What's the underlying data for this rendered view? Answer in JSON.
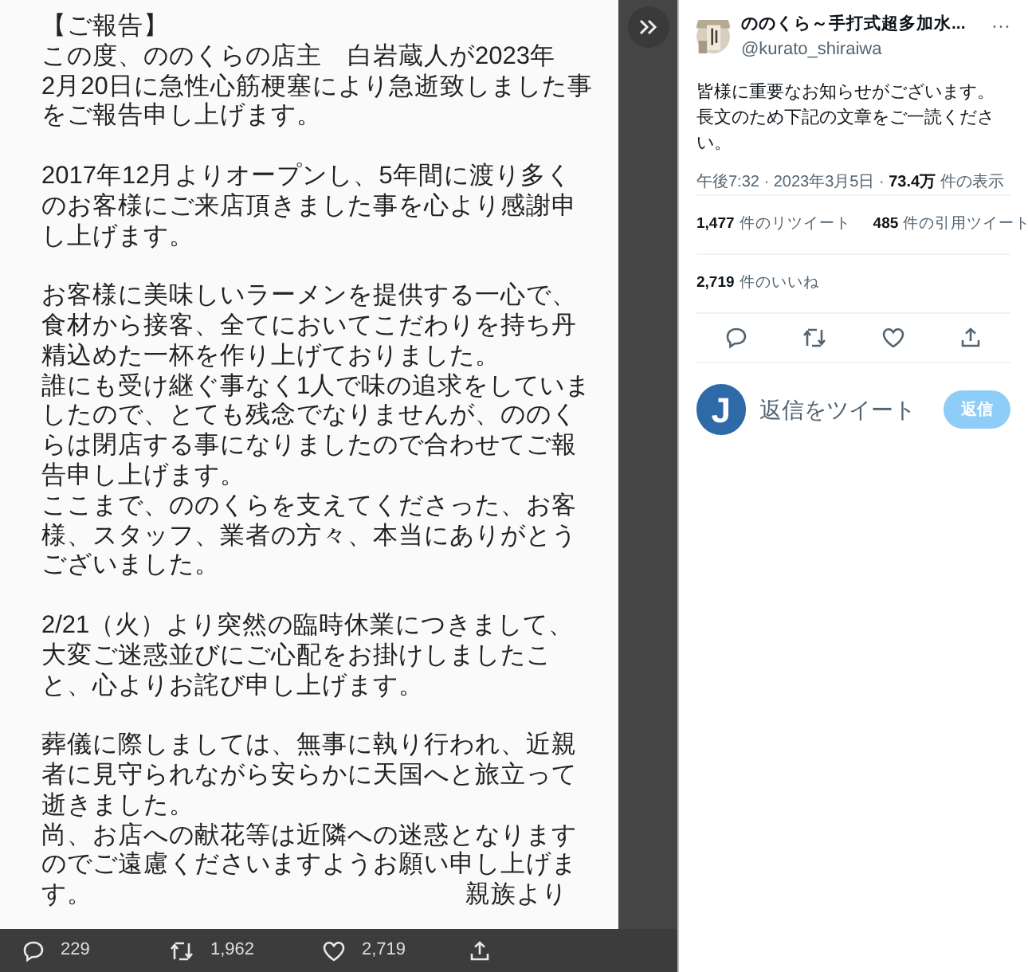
{
  "notice_image": {
    "paragraphs": [
      [
        "【ご報告】",
        "この度、ののくらの店主　白岩蔵人が2023年",
        "2月20日に急性心筋梗塞により急逝致しました事",
        "をご報告申し上げます。"
      ],
      [
        "2017年12月よりオープンし、5年間に渡り多く",
        "のお客様にご来店頂きました事を心より感謝申",
        "し上げます。"
      ],
      [
        "お客様に美味しいラーメンを提供する一心で、",
        "食材から接客、全てにおいてこだわりを持ち丹",
        "精込めた一杯を作り上げておりました。",
        "誰にも受け継ぐ事なく1人で味の追求をしていま",
        "したので、とても残念でなりませんが、ののく",
        "らは閉店する事になりましたので合わせてご報",
        "告申し上げます。",
        "ここまで、ののくらを支えてくださった、お客",
        "様、スタッフ、業者の方々、本当にありがとう",
        "ございました。"
      ],
      [
        "2/21（火）より突然の臨時休業につきまして、",
        "大変ご迷惑並びにご心配をお掛けしましたこ",
        "と、心よりお詫び申し上げます。"
      ],
      [
        "葬儀に際しましては、無事に執り行われ、近親",
        "者に見守られながら安らかに天国へと旅立って",
        "逝きました。",
        "尚、お店への献花等は近隣への迷惑となります",
        "のでご遠慮くださいますようお願い申し上げま",
        "す。"
      ]
    ],
    "signature": "親族より"
  },
  "viewer_bar": {
    "actions": [
      {
        "kind": "reply",
        "count": "229"
      },
      {
        "kind": "retweet",
        "count": "1,962"
      },
      {
        "kind": "like",
        "count": "2,719"
      },
      {
        "kind": "share"
      }
    ]
  },
  "tweet": {
    "author_name": "ののくら～手打式超多加水...",
    "handle": "@kurato_shiraiwa",
    "more": "···",
    "text": "皆様に重要なお知らせがございます。長文のため下記の文章をご一読ください。",
    "meta": "午後7:32 · 2023年3月5日 · ",
    "views_count": "73.4万",
    "views_label": " 件の表示",
    "stats_rows": [
      [
        {
          "count": "1,477",
          "label": "件のリツイート"
        },
        {
          "count": "485",
          "label": "件の引用ツイート"
        }
      ],
      [
        {
          "count": "2,719",
          "label": "件のいいね"
        }
      ]
    ],
    "actions": [
      {
        "kind": "reply"
      },
      {
        "kind": "retweet"
      },
      {
        "kind": "like"
      },
      {
        "kind": "share"
      }
    ],
    "reply_box": {
      "avatar_letter": "J",
      "placeholder": "返信をツイート",
      "button": "返信",
      "disabled": true
    }
  }
}
